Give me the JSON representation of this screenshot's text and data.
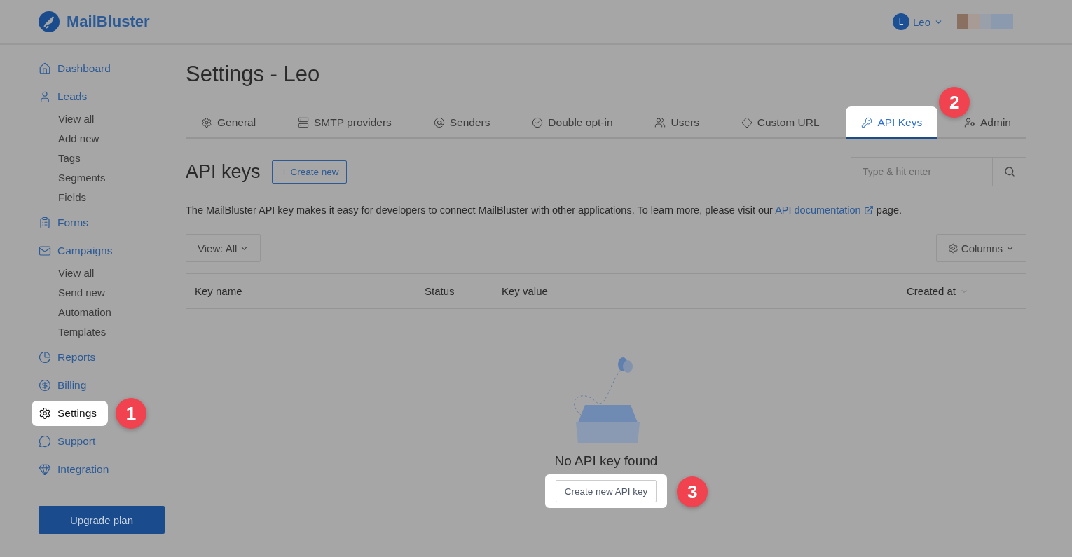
{
  "brand": {
    "name": "MailBluster"
  },
  "user": {
    "initial": "L",
    "name": "Leo"
  },
  "sidebar": {
    "items": [
      {
        "label": "Dashboard",
        "highlighted": false
      },
      {
        "label": "Leads",
        "highlighted": false,
        "children": [
          {
            "label": "View all"
          },
          {
            "label": "Add new"
          },
          {
            "label": "Tags"
          },
          {
            "label": "Segments"
          },
          {
            "label": "Fields"
          }
        ]
      },
      {
        "label": "Forms",
        "highlighted": false
      },
      {
        "label": "Campaigns",
        "highlighted": false,
        "children": [
          {
            "label": "View all"
          },
          {
            "label": "Send new"
          },
          {
            "label": "Automation"
          },
          {
            "label": "Templates"
          }
        ]
      },
      {
        "label": "Reports",
        "highlighted": false
      },
      {
        "label": "Billing",
        "highlighted": false
      },
      {
        "label": "Settings",
        "highlighted": true,
        "step": "1"
      },
      {
        "label": "Support",
        "highlighted": false
      },
      {
        "label": "Integration",
        "highlighted": false
      }
    ],
    "upgrade_button": "Upgrade plan"
  },
  "page_title": "Settings - Leo",
  "tabs": [
    {
      "label": "General",
      "selected": false,
      "highlighted": false
    },
    {
      "label": "SMTP providers",
      "selected": false,
      "highlighted": false
    },
    {
      "label": "Senders",
      "selected": false,
      "highlighted": false
    },
    {
      "label": "Double opt-in",
      "selected": false,
      "highlighted": false
    },
    {
      "label": "Users",
      "selected": false,
      "highlighted": false
    },
    {
      "label": "Custom URL",
      "selected": false,
      "highlighted": false
    },
    {
      "label": "API Keys",
      "selected": true,
      "highlighted": true,
      "step": "2"
    },
    {
      "label": "Admin",
      "selected": false,
      "highlighted": false
    }
  ],
  "section": {
    "title": "API keys",
    "create_button": "Create new",
    "search": {
      "placeholder": "Type & hit enter"
    },
    "description": "The MailBluster API key makes it easy for developers to connect MailBluster with other applications. To learn more, please visit our ",
    "link": "API documentation",
    "description_end": " page."
  },
  "view_filter": "View: All",
  "columns_button": "Columns",
  "table": {
    "columns": [
      {
        "label": "Key name",
        "sortable": false
      },
      {
        "label": "Status",
        "sortable": false
      },
      {
        "label": "Key value",
        "sortable": false
      },
      {
        "label": "Created at",
        "sortable": true
      }
    ]
  },
  "empty_state": {
    "message": "No API key found",
    "button": "Create new API key",
    "highlighted": true,
    "step": "3"
  }
}
